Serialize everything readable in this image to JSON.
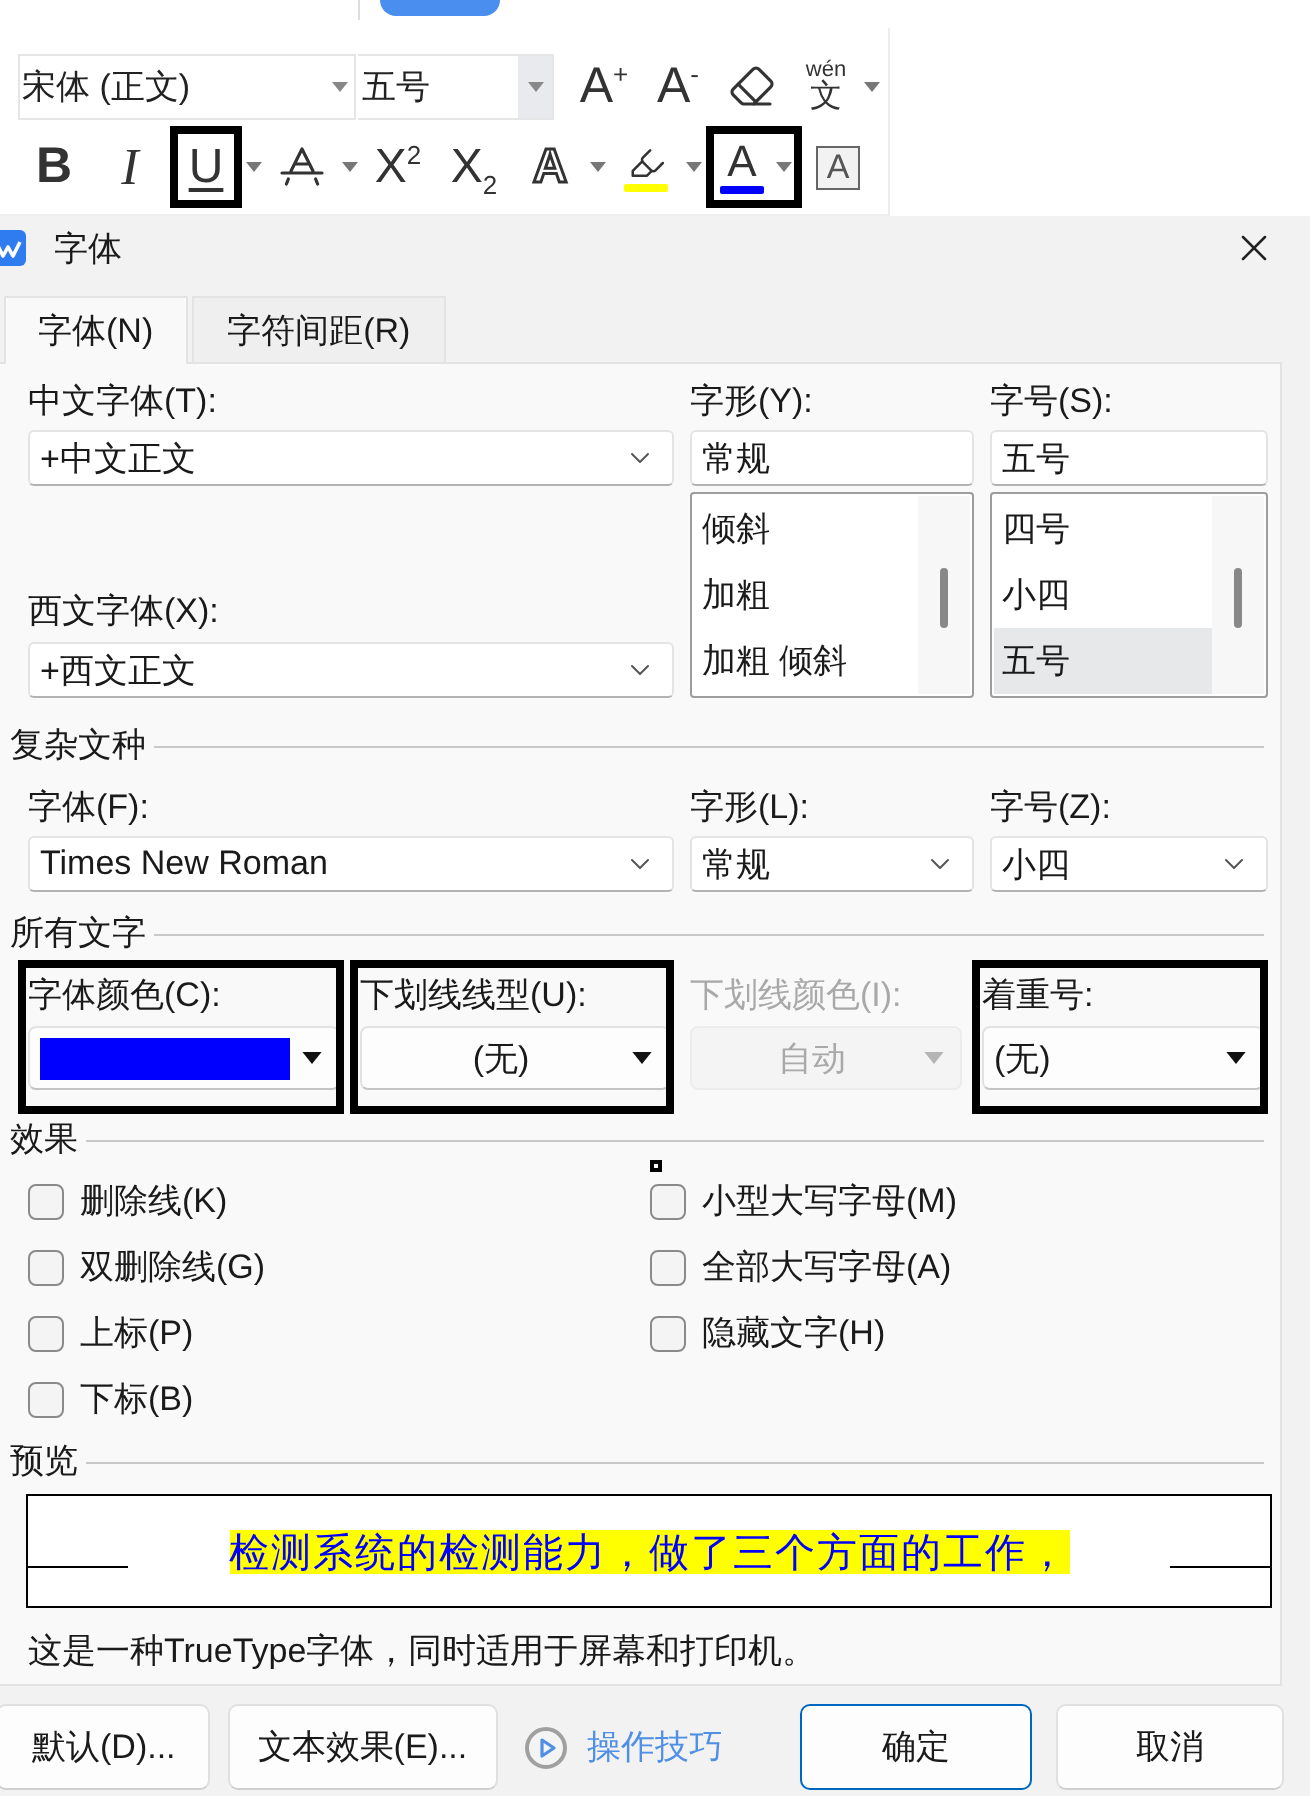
{
  "ribbon": {
    "font_name": "宋体 (正文)",
    "font_size": "五号",
    "row_1": [
      {
        "kind": "grow_font",
        "glyph": "A$^{+}$",
        "dropdown": false,
        "highlighted": false
      },
      {
        "kind": "shrink_font",
        "glyph": "A$^{-}$",
        "dropdown": false,
        "highlighted": false
      },
      {
        "kind": "clear_format",
        "dropdown": false,
        "highlighted": false
      },
      {
        "kind": "phonetic_guide",
        "pinyin": "wén",
        "glyph": "文",
        "dropdown": true,
        "highlighted": false
      }
    ],
    "row_2": [
      {
        "kind": "bold",
        "glyph": "B",
        "dropdown": false,
        "highlighted": false
      },
      {
        "kind": "italic",
        "glyph": "I",
        "dropdown": false,
        "highlighted": false
      },
      {
        "kind": "underline",
        "glyph": "U",
        "dropdown": true,
        "highlighted": true
      },
      {
        "kind": "strikethrough",
        "dropdown": true,
        "highlighted": false
      },
      {
        "kind": "superscript",
        "glyph": "X$^{2}$",
        "dropdown": false,
        "highlighted": false
      },
      {
        "kind": "subscript",
        "glyph": "X$_{2}$",
        "dropdown": false,
        "highlighted": false
      },
      {
        "kind": "text_effect",
        "glyph": "A",
        "dropdown": true,
        "highlighted": false
      },
      {
        "kind": "highlight",
        "color": "#ffff00",
        "dropdown": true,
        "highlighted": false
      },
      {
        "kind": "font_color",
        "glyph": "A",
        "color": "#0000ff",
        "dropdown": true,
        "highlighted": true
      },
      {
        "kind": "char_border",
        "glyph": "A",
        "dropdown": false,
        "highlighted": false
      }
    ]
  },
  "dialog": {
    "title": "字体",
    "tabs": [
      {
        "label": "字体(N)",
        "selected": true
      },
      {
        "label": "字符间距(R)",
        "selected": false
      }
    ],
    "chinese_font": {
      "label": "中文字体(T):",
      "value": "+中文正文"
    },
    "font_style": {
      "label": "字形(Y):",
      "value": "常规",
      "options": [
        {
          "label": "倾斜",
          "selected": false
        },
        {
          "label": "加粗",
          "selected": false
        },
        {
          "label": "加粗 倾斜",
          "selected": false
        }
      ]
    },
    "font_size": {
      "label": "字号(S):",
      "value": "五号",
      "options": [
        {
          "label": "四号",
          "selected": false
        },
        {
          "label": "小四",
          "selected": false
        },
        {
          "label": "五号",
          "selected": true
        }
      ]
    },
    "western_font": {
      "label": "西文字体(X):",
      "value": "+西文正文"
    },
    "complex_script": {
      "heading": "复杂文种",
      "fields": [
        {
          "label": "字体(F):",
          "value": "Times New Roman"
        },
        {
          "label": "字形(L):",
          "value": "常规"
        },
        {
          "label": "字号(Z):",
          "value": "小四"
        }
      ]
    },
    "all_text": {
      "heading": "所有文字",
      "fields": [
        {
          "kind": "color",
          "label": "字体颜色(C):",
          "color": "#0000ff",
          "disabled": false,
          "highlighted": true
        },
        {
          "kind": "line_style",
          "label": "下划线线型(U):",
          "value": "(无)",
          "disabled": false,
          "highlighted": true
        },
        {
          "kind": "line_color",
          "label": "下划线颜色(I):",
          "value": "自动",
          "disabled": true,
          "highlighted": false
        },
        {
          "kind": "emphasis",
          "label": "着重号:",
          "value": "(无)",
          "disabled": false,
          "highlighted": true
        }
      ]
    },
    "effects": {
      "heading": "效果",
      "options": [
        {
          "label": "删除线(K)",
          "checked": false
        },
        {
          "label": "双删除线(G)",
          "checked": false
        },
        {
          "label": "上标(P)",
          "checked": false
        },
        {
          "label": "下标(B)",
          "checked": false
        },
        {
          "label": "小型大写字母(M)",
          "checked": false
        },
        {
          "label": "全部大写字母(A)",
          "checked": false
        },
        {
          "label": "隐藏文字(H)",
          "checked": false
        }
      ]
    },
    "preview": {
      "heading": "预览",
      "sample": "检测系统的检测能力，做了三个方面的工作，",
      "note": "这是一种TrueType字体，同时适用于屏幕和打印机。"
    },
    "buttons": [
      {
        "kind": "button",
        "label": "默认(D)..."
      },
      {
        "kind": "button",
        "label": "文本效果(E)..."
      },
      {
        "kind": "link",
        "label": "操作技巧"
      },
      {
        "kind": "primary",
        "label": "确定"
      },
      {
        "kind": "button",
        "label": "取消"
      }
    ]
  }
}
